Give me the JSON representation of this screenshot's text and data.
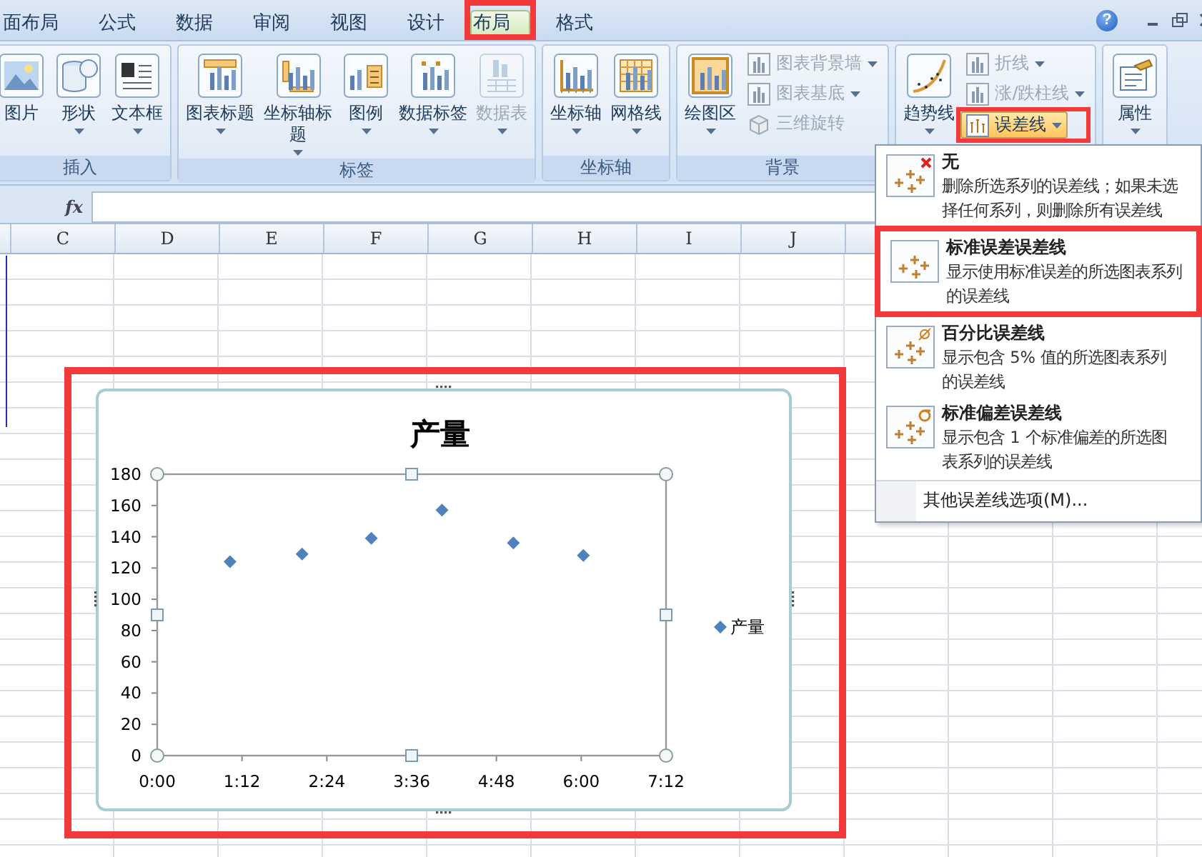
{
  "tabs": [
    {
      "label": "面布局",
      "selected": false
    },
    {
      "label": "公式",
      "selected": false
    },
    {
      "label": "数据",
      "selected": false
    },
    {
      "label": "审阅",
      "selected": false
    },
    {
      "label": "视图",
      "selected": false
    },
    {
      "label": "设计",
      "selected": false
    },
    {
      "label": "布局",
      "selected": true
    },
    {
      "label": "格式",
      "selected": false
    }
  ],
  "help_button": "?",
  "ribbon": {
    "groups": [
      {
        "label": "插入",
        "items": [
          {
            "kind": "large",
            "label": "图片",
            "caret": false,
            "disabled": false
          },
          {
            "kind": "large",
            "label": "形状",
            "caret": true,
            "disabled": false
          },
          {
            "kind": "large",
            "label": "文本框",
            "caret": true,
            "disabled": false
          }
        ]
      },
      {
        "label": "标签",
        "items": [
          {
            "kind": "large",
            "label": "图表标题",
            "caret": true,
            "disabled": false
          },
          {
            "kind": "large",
            "label": "坐标轴标题",
            "caret": true,
            "disabled": false
          },
          {
            "kind": "large",
            "label": "图例",
            "caret": true,
            "disabled": false
          },
          {
            "kind": "large",
            "label": "数据标签",
            "caret": true,
            "disabled": false
          },
          {
            "kind": "large",
            "label": "数据表",
            "caret": true,
            "disabled": true
          }
        ]
      },
      {
        "label": "坐标轴",
        "items": [
          {
            "kind": "large",
            "label": "坐标轴",
            "caret": true,
            "disabled": false
          },
          {
            "kind": "large",
            "label": "网格线",
            "caret": true,
            "disabled": false
          }
        ]
      },
      {
        "label": "背景",
        "items": [
          {
            "kind": "large",
            "label": "绘图区",
            "caret": true,
            "disabled": false
          },
          {
            "kind": "small",
            "label": "图表背景墙",
            "caret": true,
            "disabled": true
          },
          {
            "kind": "small",
            "label": "图表基底",
            "caret": true,
            "disabled": true
          },
          {
            "kind": "small",
            "label": "三维旋转",
            "caret": false,
            "disabled": true
          }
        ]
      },
      {
        "items": [
          {
            "kind": "large",
            "label": "趋势线",
            "caret": true,
            "disabled": false
          },
          {
            "kind": "small",
            "label": "折线",
            "caret": true,
            "disabled": true
          },
          {
            "kind": "small",
            "label": "涨/跌柱线",
            "caret": true,
            "disabled": true
          },
          {
            "kind": "small",
            "label": "误差线",
            "caret": true,
            "disabled": false,
            "pressed": true
          }
        ]
      },
      {
        "items": [
          {
            "kind": "large",
            "label": "属性",
            "caret": true,
            "disabled": false
          }
        ]
      }
    ]
  },
  "formula_bar": {
    "function_label": "fx"
  },
  "columns": [
    "C",
    "D",
    "E",
    "F",
    "G",
    "H",
    "I",
    "J"
  ],
  "chart": {
    "chart_data": {
      "type": "scatter",
      "title": "产量",
      "x": [
        1.03,
        2.05,
        3.03,
        4.03,
        5.04,
        6.03
      ],
      "series": [
        {
          "name": "产量",
          "color": "#4f81bd",
          "values": [
            124,
            129,
            139,
            157,
            136,
            128
          ]
        }
      ],
      "xlim": [
        0,
        7.2
      ],
      "ylim": [
        0,
        180
      ],
      "xticks": [
        {
          "value": 0,
          "label": "0:00"
        },
        {
          "value": 1.2,
          "label": "1:12"
        },
        {
          "value": 2.4,
          "label": "2:24"
        },
        {
          "value": 3.6,
          "label": "3:36"
        },
        {
          "value": 4.8,
          "label": "4:48"
        },
        {
          "value": 6,
          "label": "6:00"
        },
        {
          "value": 7.2,
          "label": "7:12"
        }
      ],
      "yticks": [
        0,
        20,
        40,
        60,
        80,
        100,
        120,
        140,
        160,
        180
      ]
    }
  },
  "menu": {
    "items": [
      {
        "kind": "none",
        "title": "无",
        "description": [
          "删除所选系列的误差线；如果未选",
          "择任何系列，则删除所有误差线"
        ]
      },
      {
        "kind": "standard",
        "title": "标准误差误差线",
        "description": [
          "显示使用标准误差的所选图表系列",
          "的误差线"
        ]
      },
      {
        "kind": "percent",
        "title": "百分比误差线",
        "description": [
          "显示包含 5% 值的所选图表系列",
          "的误差线"
        ]
      },
      {
        "kind": "deviation",
        "title": "标准偏差误差线",
        "description": [
          "显示包含 1 个标准偏差的所选图",
          "表系列的误差线"
        ]
      }
    ],
    "more": "其他误差线选项(M)..."
  }
}
